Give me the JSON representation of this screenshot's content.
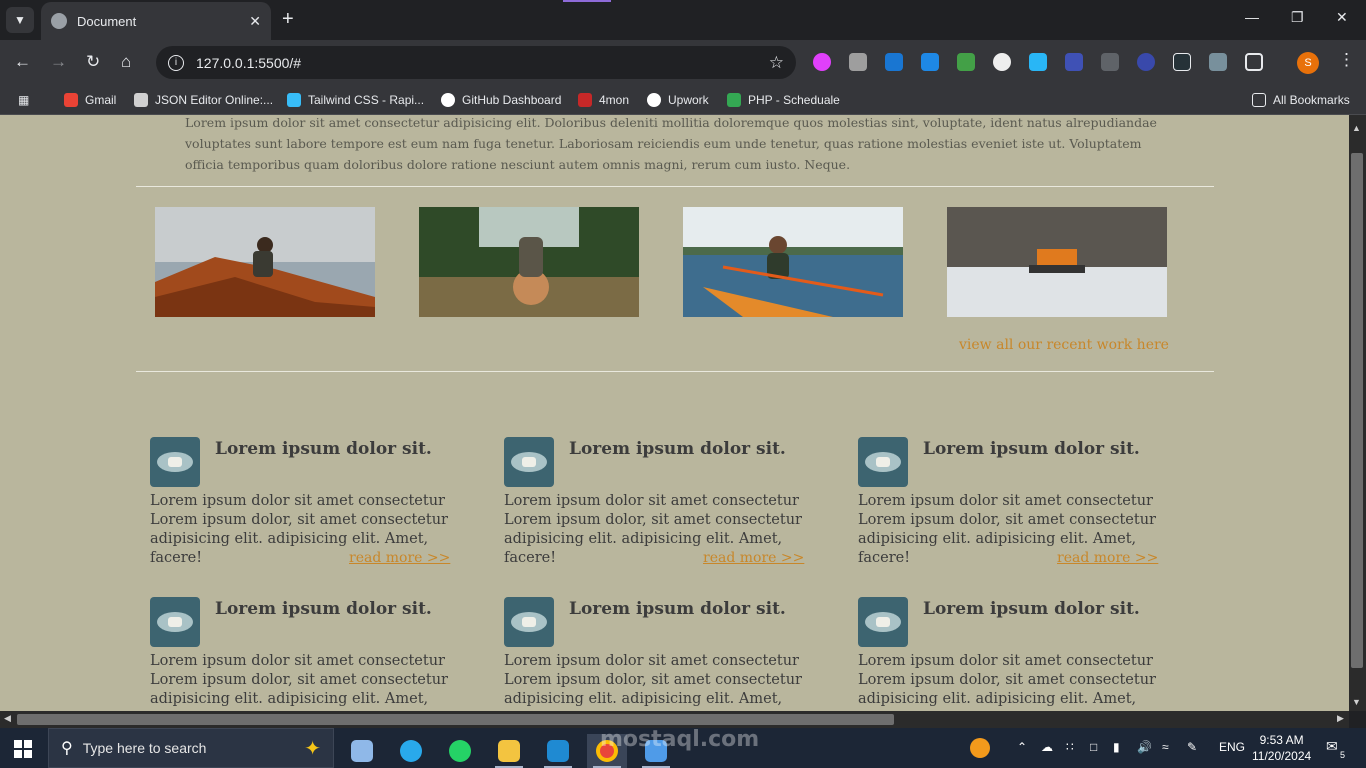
{
  "browser": {
    "tab_title": "Document",
    "url": "127.0.0.1:5500/#",
    "bookmarks": [
      {
        "label": "Gmail",
        "color": "#ea4335"
      },
      {
        "label": "JSON Editor Online:...",
        "color": "#d0d0d0"
      },
      {
        "label": "Tailwind CSS - Rapi...",
        "color": "#38bdf8"
      },
      {
        "label": "GitHub Dashboard",
        "color": "#ffffff"
      },
      {
        "label": "4mon",
        "color": "#c62828"
      },
      {
        "label": "Upwork",
        "color": "#ffffff"
      },
      {
        "label": "PHP - Scheduale",
        "color": "#34a853"
      }
    ],
    "all_bookmarks": "All Bookmarks",
    "profile_initial": "S"
  },
  "page": {
    "intro": "Lorem ipsum dolor sit amet consectetur adipisicing elit. Doloribus deleniti mollitia doloremque quos molestias sint, voluptate, ident natus alrepudiandae voluptates sunt labore tempore est eum nam fuga tenetur. Laboriosam reiciendis eum unde tenetur, quas ratione molestias eveniet iste ut. Voluptatem officia temporibus quam doloribus dolore ratione nesciunt autem omnis magni, rerum cum iusto. Neque.",
    "view_all": "view all our recent work here",
    "cards": [
      {
        "title": "Lorem ipsum dolor sit.",
        "body": "Lorem ipsum dolor sit amet consectetur Lorem ipsum dolor, sit amet consectetur adipisicing elit. adipisicing elit. Amet, facere!",
        "more": "read more >>"
      },
      {
        "title": "Lorem ipsum dolor sit.",
        "body": "Lorem ipsum dolor sit amet consectetur Lorem ipsum dolor, sit amet consectetur adipisicing elit. adipisicing elit. Amet, facere!",
        "more": "read more >>"
      },
      {
        "title": "Lorem ipsum dolor sit.",
        "body": "Lorem ipsum dolor sit amet consectetur Lorem ipsum dolor, sit amet consectetur adipisicing elit. adipisicing elit. Amet, facere!",
        "more": "read more >>"
      },
      {
        "title": "Lorem ipsum dolor sit.",
        "body": "Lorem ipsum dolor sit amet consectetur Lorem ipsum dolor, sit amet consectetur adipisicing elit. adipisicing elit. Amet, facere!",
        "more": ""
      },
      {
        "title": "Lorem ipsum dolor sit.",
        "body": "Lorem ipsum dolor sit amet consectetur Lorem ipsum dolor, sit amet consectetur adipisicing elit. adipisicing elit. Amet, facere!",
        "more": ""
      },
      {
        "title": "Lorem ipsum dolor sit.",
        "body": "Lorem ipsum dolor sit amet consectetur Lorem ipsum dolor, sit amet consectetur adipisicing elit. adipisicing elit. Amet, facere!",
        "more": ""
      }
    ]
  },
  "taskbar": {
    "search_placeholder": "Type here to search",
    "language": "ENG",
    "time": "9:53 AM",
    "date": "11/20/2024",
    "notification_count": "5",
    "watermark": "mostaql.com"
  },
  "colors": {
    "page_bg": "#b9b69d",
    "link": "#c8872a"
  }
}
